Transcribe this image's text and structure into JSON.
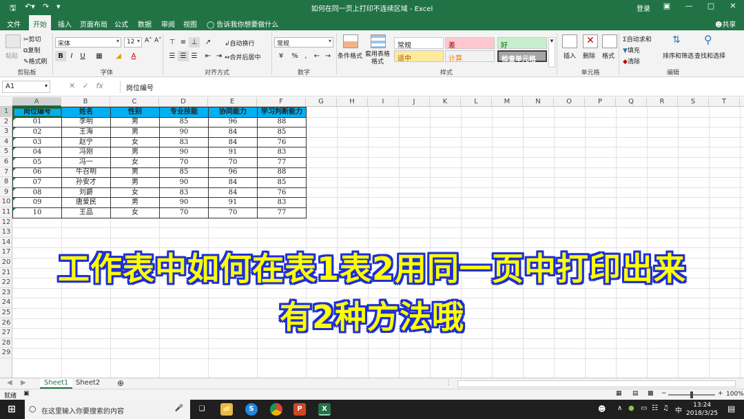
{
  "window": {
    "doc_title": "如何在同一页上打印不连续区域 - Excel",
    "login": "登录"
  },
  "ribbon_tabs": [
    "文件",
    "开始",
    "插入",
    "页面布局",
    "公式",
    "数据",
    "审阅",
    "视图"
  ],
  "tell_me": "告诉我你想要做什么",
  "share": "共享",
  "clipboard": {
    "cut": "剪切",
    "copy": "复制",
    "format_painter": "格式刷",
    "paste": "粘贴",
    "group": "剪贴板"
  },
  "font": {
    "name": "宋体",
    "size": "12",
    "group": "字体",
    "bold": "B",
    "italic": "I",
    "underline": "U"
  },
  "alignment": {
    "wrap": "自动换行",
    "merge": "合并后居中",
    "group": "对齐方式"
  },
  "number": {
    "format": "常规",
    "percent": "%",
    "comma": ",",
    "group": "数字"
  },
  "styles": {
    "conditional": "条件格式",
    "as_table": "套用表格格式",
    "group": "样式",
    "cells": [
      {
        "label": "常规",
        "bg": "#ffffff",
        "fg": "#222222"
      },
      {
        "label": "差",
        "bg": "#ffc7ce",
        "fg": "#9c0006"
      },
      {
        "label": "好",
        "bg": "#c6efce",
        "fg": "#006100"
      },
      {
        "label": "适中",
        "bg": "#ffeb9c",
        "fg": "#9c5700"
      },
      {
        "label": "计算",
        "bg": "#f2f2f2",
        "fg": "#fa7d00"
      },
      {
        "label": "检查单元格",
        "bg": "#a5a5a5",
        "fg": "#ffffff"
      }
    ]
  },
  "cells_group": {
    "insert": "插入",
    "delete": "删除",
    "format": "格式",
    "group": "单元格"
  },
  "editing": {
    "autosum": "自动求和",
    "fill": "填充",
    "clear": "清除",
    "sort": "排序和筛选",
    "find": "查找和选择",
    "group": "编辑"
  },
  "formula_bar": {
    "name_box": "A1",
    "fx": "fx",
    "content": "岗位编号"
  },
  "columns": [
    "A",
    "B",
    "C",
    "D",
    "E",
    "F",
    "G",
    "H",
    "I",
    "J",
    "K",
    "L",
    "M",
    "N",
    "O",
    "P",
    "Q",
    "R",
    "S",
    "T"
  ],
  "table": {
    "headers": [
      "岗位编号",
      "姓名",
      "性别",
      "专业技能",
      "协同能力",
      "学习判断能力"
    ],
    "rows": [
      [
        "01",
        "李明",
        "男",
        "85",
        "96",
        "88"
      ],
      [
        "02",
        "王海",
        "男",
        "90",
        "84",
        "85"
      ],
      [
        "03",
        "赵宁",
        "女",
        "83",
        "84",
        "76"
      ],
      [
        "04",
        "冯刚",
        "男",
        "90",
        "91",
        "83"
      ],
      [
        "05",
        "冯一",
        "女",
        "70",
        "70",
        "77"
      ],
      [
        "06",
        "牛召明",
        "男",
        "85",
        "96",
        "88"
      ],
      [
        "07",
        "孙安才",
        "男",
        "90",
        "84",
        "85"
      ],
      [
        "08",
        "刘爵",
        "女",
        "83",
        "84",
        "76"
      ],
      [
        "09",
        "唐爱民",
        "男",
        "90",
        "91",
        "83"
      ],
      [
        "10",
        "王品",
        "女",
        "70",
        "70",
        "77"
      ]
    ]
  },
  "row_numbers": [
    "1",
    "2",
    "3",
    "4",
    "5",
    "6",
    "7",
    "8",
    "9",
    "10",
    "11",
    "12",
    "13",
    "14",
    "17",
    "20",
    "21",
    "22",
    "23",
    "24",
    "25",
    "26",
    "27",
    "28",
    "29"
  ],
  "overlay": {
    "line1": "工作表中如何在表1表2用同一页中打印出来",
    "line2": "有2种方法哦"
  },
  "sheets": [
    "Sheet1",
    "Sheet2"
  ],
  "status": {
    "ready": "就绪",
    "zoom": "100%"
  },
  "taskbar": {
    "search_placeholder": "在这里输入你要搜索的内容",
    "time": "13:24",
    "date": "2018/3/25",
    "ime": "中"
  }
}
